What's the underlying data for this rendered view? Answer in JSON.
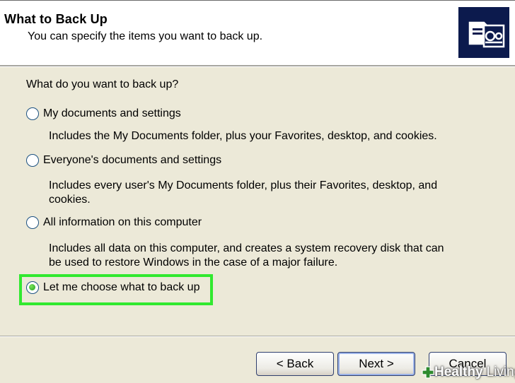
{
  "header": {
    "title": "What to Back Up",
    "subtitle": "You can specify the items you want to back up."
  },
  "question": "What do you want to back up?",
  "options": [
    {
      "label": "My documents and settings",
      "description": "Includes the My Documents folder, plus your Favorites, desktop, and cookies.",
      "selected": false
    },
    {
      "label": "Everyone's documents and settings",
      "description": "Includes every user's My Documents folder, plus their Favorites, desktop, and cookies.",
      "selected": false
    },
    {
      "label": "All information on this computer",
      "description": "Includes all data on this computer, and creates a system recovery disk that can be used to restore Windows in the case of a major failure.",
      "selected": false
    },
    {
      "label": "Let me choose what to back up",
      "selected": true
    }
  ],
  "buttons": {
    "back": "< Back",
    "next": "Next >",
    "cancel": "Cancel"
  },
  "watermark": {
    "brand": "Healthy",
    "suffix": "Living"
  },
  "colors": {
    "highlight": "#31e92f",
    "header_icon_bg": "#0c1a4d",
    "dialog_bg": "#ece9d8"
  },
  "icons": {
    "header": "backup-wizard-icon",
    "watermark": "plus-icon"
  }
}
